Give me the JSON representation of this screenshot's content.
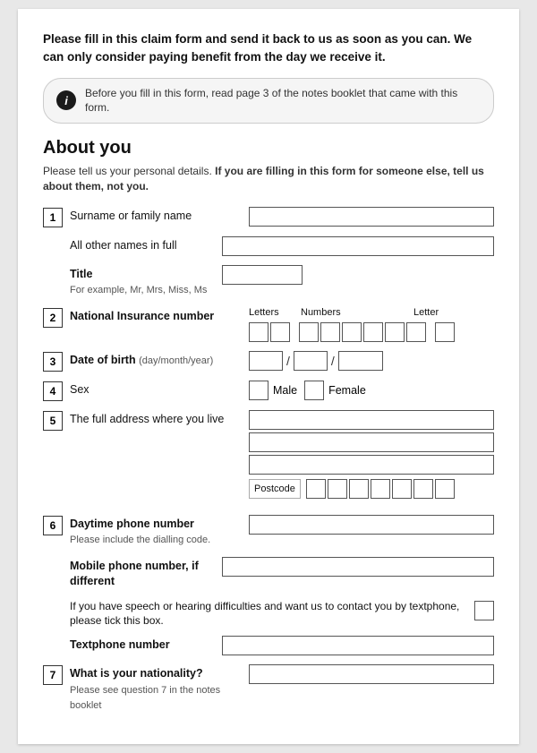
{
  "intro": {
    "text": "Please fill in this claim form and send it back to us as soon as you can. We can only consider paying benefit from the day we receive it."
  },
  "infobox": {
    "icon": "i",
    "text": "Before you fill in this form, read page 3 of the notes booklet that came with this form."
  },
  "about_section": {
    "title": "About you",
    "description_normal": "Please tell us your personal details. ",
    "description_bold": "If you are filling in this form for someone else, tell us about them, not you."
  },
  "fields": {
    "q1_label": "Surname or family name",
    "q1_num": "1",
    "all_names_label": "All other names in full",
    "title_label": "Title",
    "title_sublabel": "For example, Mr, Mrs, Miss, Ms",
    "ni_label": "National Insurance number",
    "ni_num": "2",
    "ni_headers": {
      "letters": "Letters",
      "numbers": "Numbers",
      "letter": "Letter"
    },
    "dob_label": "Date of birth",
    "dob_sublabel": "(day/month/year)",
    "dob_num": "3",
    "sex_label": "Sex",
    "sex_num": "4",
    "sex_male": "Male",
    "sex_female": "Female",
    "address_label": "The full address where you live",
    "address_num": "5",
    "postcode_label": "Postcode",
    "phone_label": "Daytime phone number",
    "phone_sublabel": "Please include the dialling code.",
    "phone_num": "6",
    "mobile_label": "Mobile phone number, if different",
    "textphone_notice": "If you have speech or hearing difficulties and want us to contact you by textphone, please tick this box.",
    "textphone_label": "Textphone number",
    "nationality_label": "What is your nationality?",
    "nationality_sublabel": "Please see question 7 in the notes booklet",
    "nationality_num": "7"
  }
}
